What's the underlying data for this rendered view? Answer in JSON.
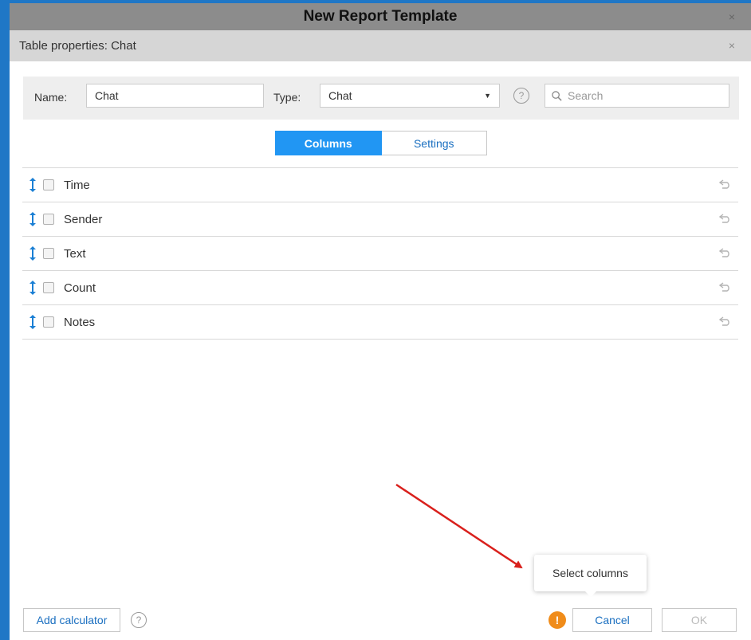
{
  "window": {
    "title": "New Report Template",
    "close_glyph": "×"
  },
  "dialog": {
    "title": "Table properties: Chat",
    "close_glyph": "×"
  },
  "filters": {
    "name_label": "Name:",
    "name_value": "Chat",
    "type_label": "Type:",
    "type_value": "Chat",
    "help_glyph": "?",
    "search_placeholder": "Search"
  },
  "tabs": [
    {
      "label": "Columns",
      "active": true
    },
    {
      "label": "Settings",
      "active": false
    }
  ],
  "columns": [
    {
      "label": "Time",
      "checked": false
    },
    {
      "label": "Sender",
      "checked": false
    },
    {
      "label": "Text",
      "checked": false
    },
    {
      "label": "Count",
      "checked": false
    },
    {
      "label": "Notes",
      "checked": false
    }
  ],
  "footer": {
    "add_calculator_label": "Add calculator",
    "help_glyph": "?",
    "warning_glyph": "!",
    "tooltip_text": "Select columns",
    "cancel_label": "Cancel",
    "ok_label": "OK"
  },
  "colors": {
    "accent": "#2196f3",
    "link": "#1a6fc0",
    "warning": "#f08c1a",
    "annotation_arrow": "#d9201c",
    "background": "#1f77c6"
  },
  "icons": {
    "drag": "drag-handle-icon",
    "undo": "undo-icon",
    "search": "search-icon",
    "help": "help-icon",
    "warning": "warning-icon",
    "close": "close-icon",
    "dropdown": "chevron-down-icon"
  }
}
